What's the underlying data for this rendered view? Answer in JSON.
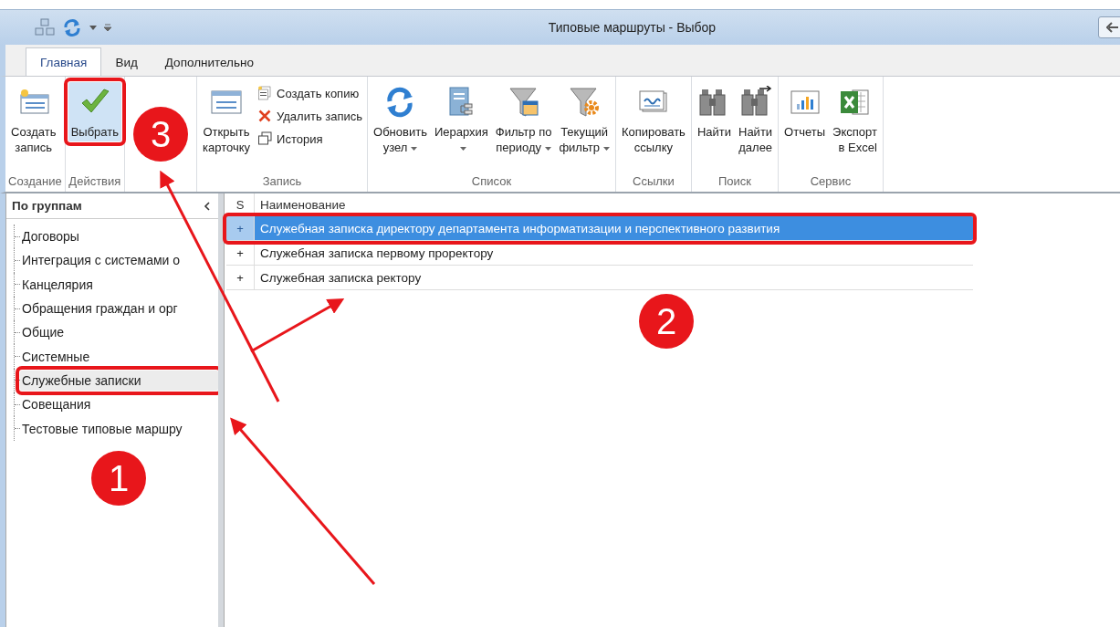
{
  "title_bar": {
    "title": "Типовые маршруты - Выбор"
  },
  "tabs": [
    {
      "label": "Главная",
      "selected": true
    },
    {
      "label": "Вид",
      "selected": false
    },
    {
      "label": "Дополнительно",
      "selected": false
    }
  ],
  "ribbon": {
    "groups": [
      {
        "label": "Создание",
        "buttons": [
          {
            "kind": "large",
            "lines": [
              "Создать",
              "запись"
            ],
            "highlighted": false,
            "framed": false,
            "dropdown": false
          }
        ]
      },
      {
        "label": "Действия",
        "buttons": [
          {
            "kind": "large",
            "lines": [
              "Выбрать"
            ],
            "highlighted": true,
            "framed": true,
            "dropdown": false
          }
        ]
      },
      {
        "label": "Запись",
        "buttons": [
          {
            "kind": "large",
            "lines": [
              "Открыть",
              "карточку"
            ],
            "highlighted": false,
            "framed": false,
            "dropdown": false
          },
          {
            "kind": "small",
            "lines": [
              "Создать копию"
            ]
          },
          {
            "kind": "small",
            "lines": [
              "Удалить запись"
            ]
          },
          {
            "kind": "small",
            "lines": [
              "История"
            ]
          }
        ]
      },
      {
        "label": "Список",
        "buttons": [
          {
            "kind": "large",
            "lines": [
              "Обновить",
              "узел"
            ],
            "highlighted": false,
            "framed": false,
            "dropdown": true
          },
          {
            "kind": "large",
            "lines": [
              "Иерархия"
            ],
            "highlighted": false,
            "framed": false,
            "dropdown": true
          },
          {
            "kind": "large",
            "lines": [
              "Фильтр по",
              "периоду"
            ],
            "highlighted": false,
            "framed": false,
            "dropdown": true
          },
          {
            "kind": "large",
            "lines": [
              "Текущий",
              "фильтр"
            ],
            "highlighted": false,
            "framed": false,
            "dropdown": true
          }
        ]
      },
      {
        "label": "Ссылки",
        "buttons": [
          {
            "kind": "large",
            "lines": [
              "Копировать",
              "ссылку"
            ],
            "highlighted": false,
            "framed": false,
            "dropdown": false
          }
        ]
      },
      {
        "label": "Поиск",
        "buttons": [
          {
            "kind": "large",
            "lines": [
              "Найти"
            ],
            "highlighted": false,
            "framed": false,
            "dropdown": false
          },
          {
            "kind": "large",
            "lines": [
              "Найти",
              "далее"
            ],
            "highlighted": false,
            "framed": false,
            "dropdown": false
          }
        ]
      },
      {
        "label": "Сервис",
        "buttons": [
          {
            "kind": "large",
            "lines": [
              "Отчеты"
            ],
            "highlighted": false,
            "framed": false,
            "dropdown": false
          },
          {
            "kind": "large",
            "lines": [
              "Экспорт",
              "в Excel"
            ],
            "highlighted": false,
            "framed": false,
            "dropdown": false
          }
        ]
      }
    ]
  },
  "sidebar": {
    "title": "По группам",
    "items": [
      {
        "label": "Договоры",
        "selected": false,
        "framed": false
      },
      {
        "label": "Интеграция с системами о",
        "selected": false,
        "framed": false
      },
      {
        "label": "Канцелярия",
        "selected": false,
        "framed": false
      },
      {
        "label": "Обращения граждан и орг",
        "selected": false,
        "framed": false
      },
      {
        "label": "Общие",
        "selected": false,
        "framed": false
      },
      {
        "label": "Системные",
        "selected": false,
        "framed": false
      },
      {
        "label": "Служебные записки",
        "selected": true,
        "framed": true
      },
      {
        "label": "Совещания",
        "selected": false,
        "framed": false
      },
      {
        "label": "Тестовые типовые маршру",
        "selected": false,
        "framed": false
      }
    ]
  },
  "table": {
    "columns": [
      "S",
      "Наименование"
    ],
    "rows": [
      {
        "marker": "+",
        "name": "Служебная записка директору департамента информатизации и перспективного развития",
        "selected": true,
        "framed": true
      },
      {
        "marker": "+",
        "name": "Служебная записка первому проректору",
        "selected": false,
        "framed": false
      },
      {
        "marker": "+",
        "name": "Служебная записка ректору",
        "selected": false,
        "framed": false
      }
    ]
  },
  "callouts": [
    {
      "number": "3"
    },
    {
      "number": "2"
    },
    {
      "number": "1"
    }
  ]
}
